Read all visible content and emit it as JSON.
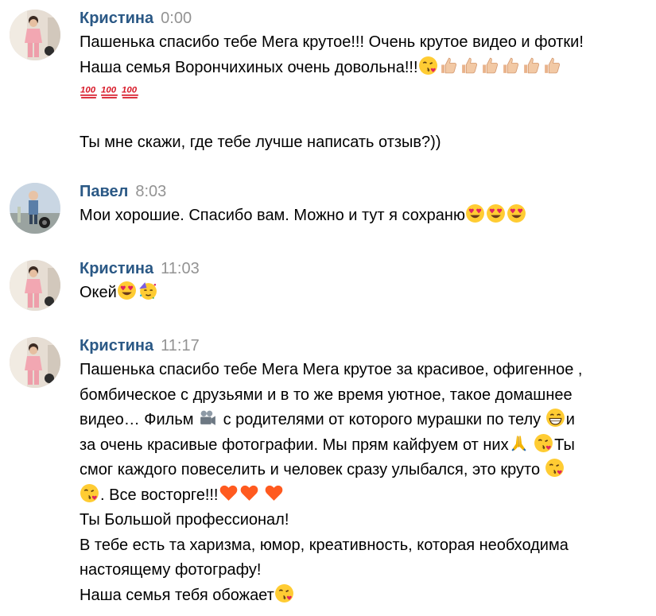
{
  "messages": [
    {
      "author": "Кристина",
      "time": "0:00",
      "avatar": "avatar-kristina",
      "lines": [
        [
          "Пашенька спасибо тебе Мега крутое!!! Очень крутое видео и фотки!"
        ],
        [
          "Наша семья Ворончихиных очень довольна!!!",
          {
            "e": "kiss-face"
          },
          {
            "e": "thumbs-up"
          },
          {
            "e": "thumbs-up"
          },
          {
            "e": "thumbs-up"
          },
          {
            "e": "thumbs-up"
          },
          {
            "e": "thumbs-up"
          },
          {
            "e": "thumbs-up"
          }
        ],
        [
          {
            "e": "hundred"
          },
          {
            "e": "hundred"
          },
          {
            "e": "hundred"
          }
        ],
        [
          ""
        ],
        [
          "Ты мне скажи, где тебе лучше написать отзыв?))"
        ]
      ]
    },
    {
      "author": "Павел",
      "time": "8:03",
      "avatar": "avatar-pavel",
      "lines": [
        [
          "Мои хорошие. Спасибо вам. Можно и тут я сохраню",
          {
            "e": "heart-eyes"
          },
          {
            "e": "heart-eyes"
          },
          {
            "e": "heart-eyes"
          }
        ]
      ]
    },
    {
      "author": "Кристина",
      "time": "11:03",
      "avatar": "avatar-kristina",
      "lines": [
        [
          "Окей",
          {
            "e": "heart-eyes"
          },
          {
            "e": "party-face"
          }
        ]
      ]
    },
    {
      "author": "Кристина",
      "time": "11:17",
      "avatar": "avatar-kristina",
      "lines": [
        [
          "Пашенька спасибо тебе Мега Мега крутое за красивое, офигенное ,"
        ],
        [
          " бомбическое с друзьями и в то же время уютное, такое домашнее"
        ],
        [
          "видео… Фильм ",
          {
            "e": "movie-camera"
          },
          " с родителями от которого мурашки по телу ",
          {
            "e": "grin-face"
          },
          "и"
        ],
        [
          "за очень красивые фотографии. Мы прям кайфуем от них",
          {
            "e": "folded-hands"
          },
          " ",
          {
            "e": "kiss-face"
          },
          "Ты"
        ],
        [
          "смог каждого повеселить и человек сразу улыбался, это круто ",
          {
            "e": "kiss-face"
          }
        ],
        [
          {
            "e": "kiss-face"
          },
          ". Все восторге!!!",
          {
            "e": "heart"
          },
          {
            "e": "heart"
          },
          " ",
          {
            "e": "heart"
          }
        ],
        [
          "Ты Большой профессионал!"
        ],
        [
          "В тебе есть та харизма, юмор, креативность, которая необходима"
        ],
        [
          "настоящему фотографу!"
        ],
        [
          "Наша семья тебя обожает",
          {
            "e": "kiss-face"
          }
        ]
      ]
    }
  ],
  "emoji_text": {
    "hundred": "100"
  },
  "colors": {
    "author": "#2a5885",
    "time": "#939393",
    "text": "#000000",
    "background": "#ffffff"
  }
}
